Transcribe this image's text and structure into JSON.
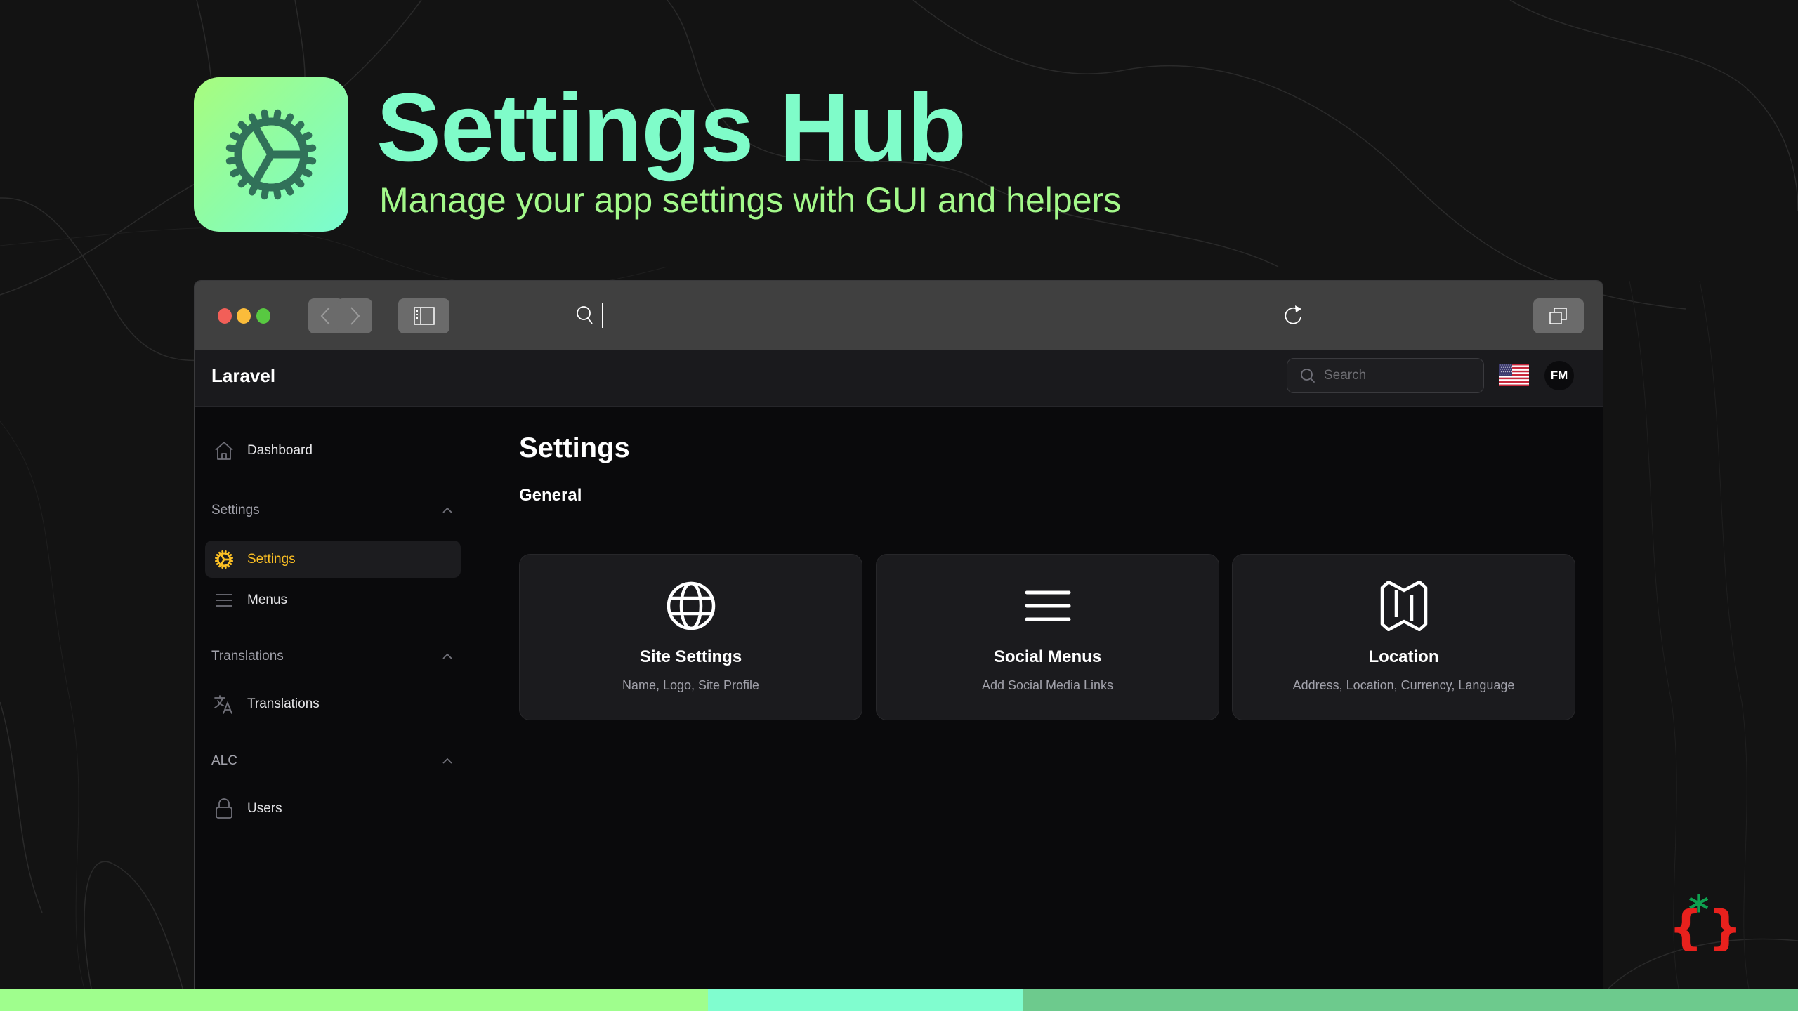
{
  "hero": {
    "title": "Settings Hub",
    "subtitle": "Manage your app settings with GUI and helpers",
    "icon": "gear-icon"
  },
  "browser": {
    "address_value": "",
    "controls": {
      "back": "chevron-left-icon",
      "forward": "chevron-right-icon",
      "sidebar": "sidebar-icon",
      "reload": "reload-icon",
      "tabs": "tabs-overview-icon"
    }
  },
  "header": {
    "brand": "Laravel",
    "search_placeholder": "Search",
    "search_value": "",
    "locale": "en-US",
    "avatar_initials": "FM"
  },
  "sidebar": {
    "dashboard": {
      "label": "Dashboard",
      "icon": "home-icon"
    },
    "groups": [
      {
        "label": "Settings",
        "expanded": true,
        "items": [
          {
            "label": "Settings",
            "icon": "gear-icon",
            "active": true
          },
          {
            "label": "Menus",
            "icon": "menu-icon",
            "active": false
          }
        ]
      },
      {
        "label": "Translations",
        "expanded": true,
        "items": [
          {
            "label": "Translations",
            "icon": "translate-icon",
            "active": false
          }
        ]
      },
      {
        "label": "ALC",
        "expanded": true,
        "items": [
          {
            "label": "Users",
            "icon": "lock-icon",
            "active": false
          }
        ]
      }
    ]
  },
  "main": {
    "title": "Settings",
    "section": "General",
    "cards": [
      {
        "title": "Site Settings",
        "description": "Name, Logo, Site Profile",
        "icon": "globe-icon"
      },
      {
        "title": "Social Menus",
        "description": "Add Social Media Links",
        "icon": "menu-icon"
      },
      {
        "title": "Location",
        "description": "Address, Location, Currency, Language",
        "icon": "map-icon"
      }
    ]
  },
  "colors": {
    "title": "#7ffcc9",
    "subtitle": "#a3f98a",
    "active": "#fbbf24",
    "bar": [
      "#9ffe8d",
      "#80fdcf",
      "#6dca8d"
    ]
  }
}
